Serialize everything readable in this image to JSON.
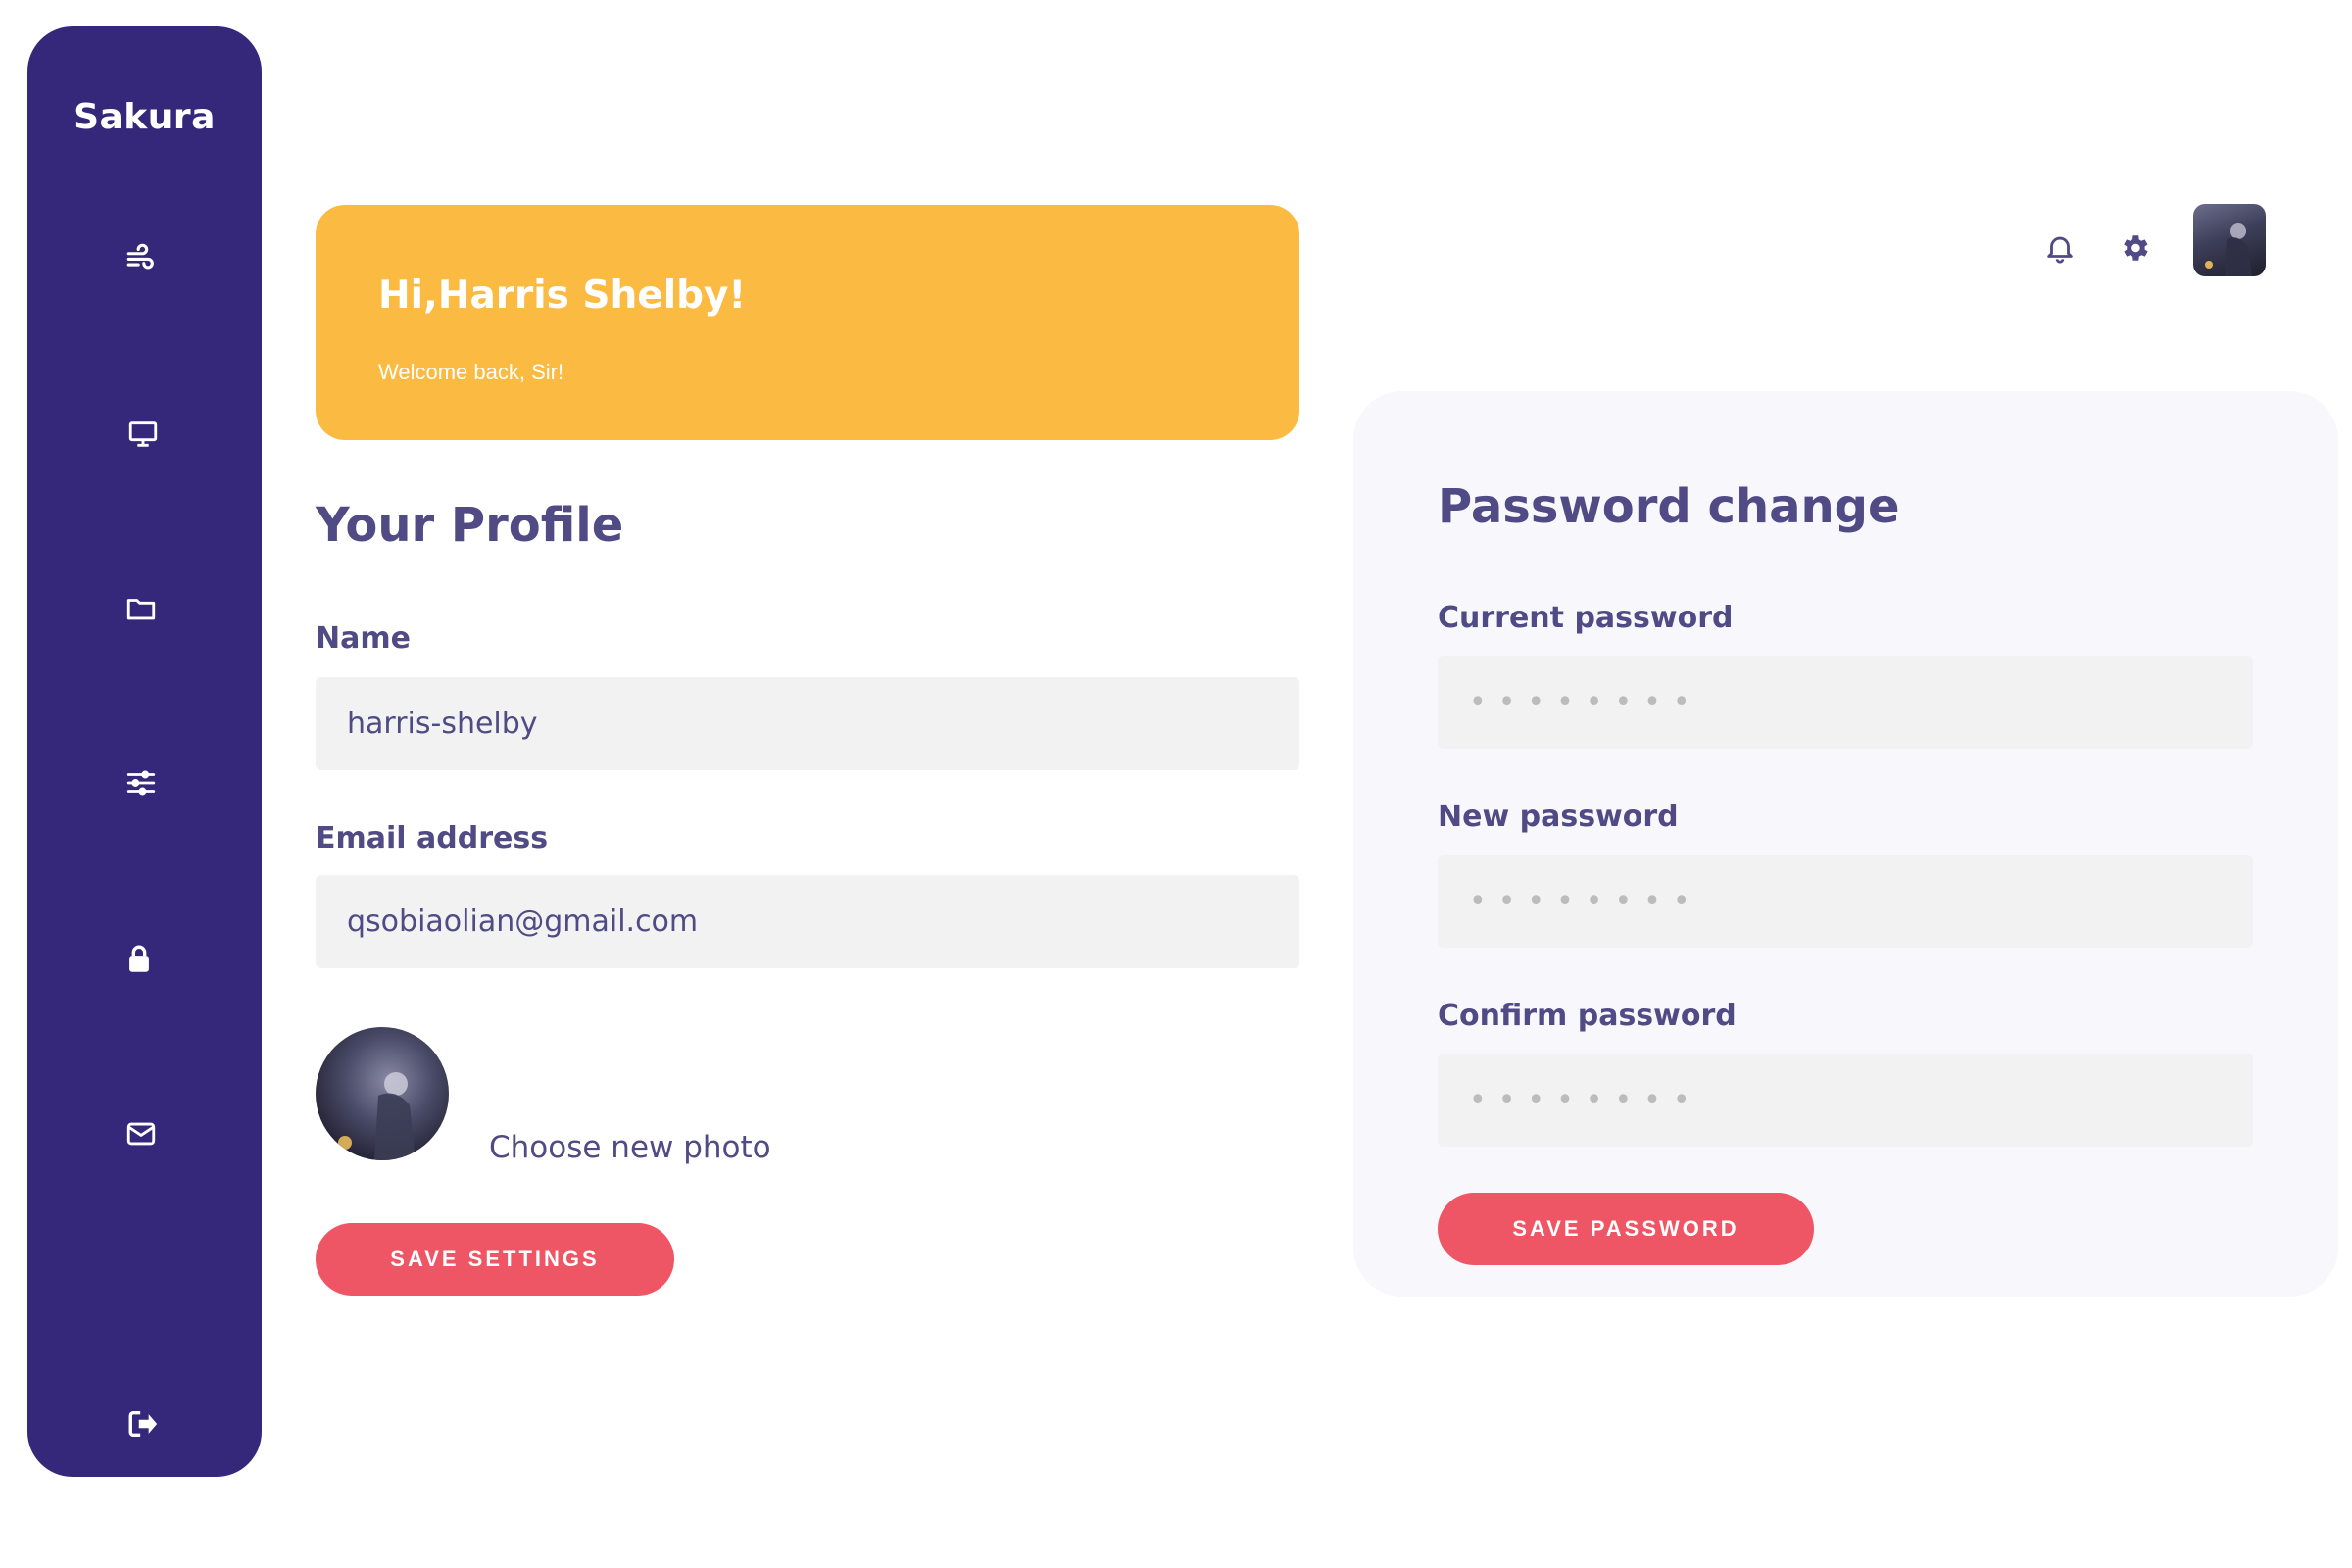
{
  "app": {
    "brand": "Sakura"
  },
  "sidebar": {
    "items": [
      {
        "icon": "wind-icon"
      },
      {
        "icon": "monitor-icon"
      },
      {
        "icon": "folder-icon"
      },
      {
        "icon": "sliders-icon"
      },
      {
        "icon": "lock-icon"
      },
      {
        "icon": "mail-icon"
      },
      {
        "icon": "logout-icon"
      }
    ]
  },
  "greeting": {
    "title": "Hi,Harris Shelby!",
    "subtitle": "Welcome back, Sir!"
  },
  "profile": {
    "title": "Your Profile",
    "name_label": "Name",
    "name_value": "harris-shelby",
    "email_label": "Email address",
    "email_value": "qsobiaolian@gmail.com",
    "choose_photo": "Choose new photo",
    "save_button": "SAVE SETTINGS"
  },
  "password": {
    "title": "Password change",
    "current_label": "Current password",
    "new_label": "New password",
    "confirm_label": "Confirm password",
    "placeholder": "••••••••",
    "save_button": "SAVE PASSWORD"
  },
  "colors": {
    "sidebar": "#35287a",
    "accent_yellow": "#fbbb42",
    "button_red": "#ee5565",
    "text_purple": "#504a85",
    "card_bg": "#f7f7fc",
    "field_bg": "#f2f2f2"
  }
}
